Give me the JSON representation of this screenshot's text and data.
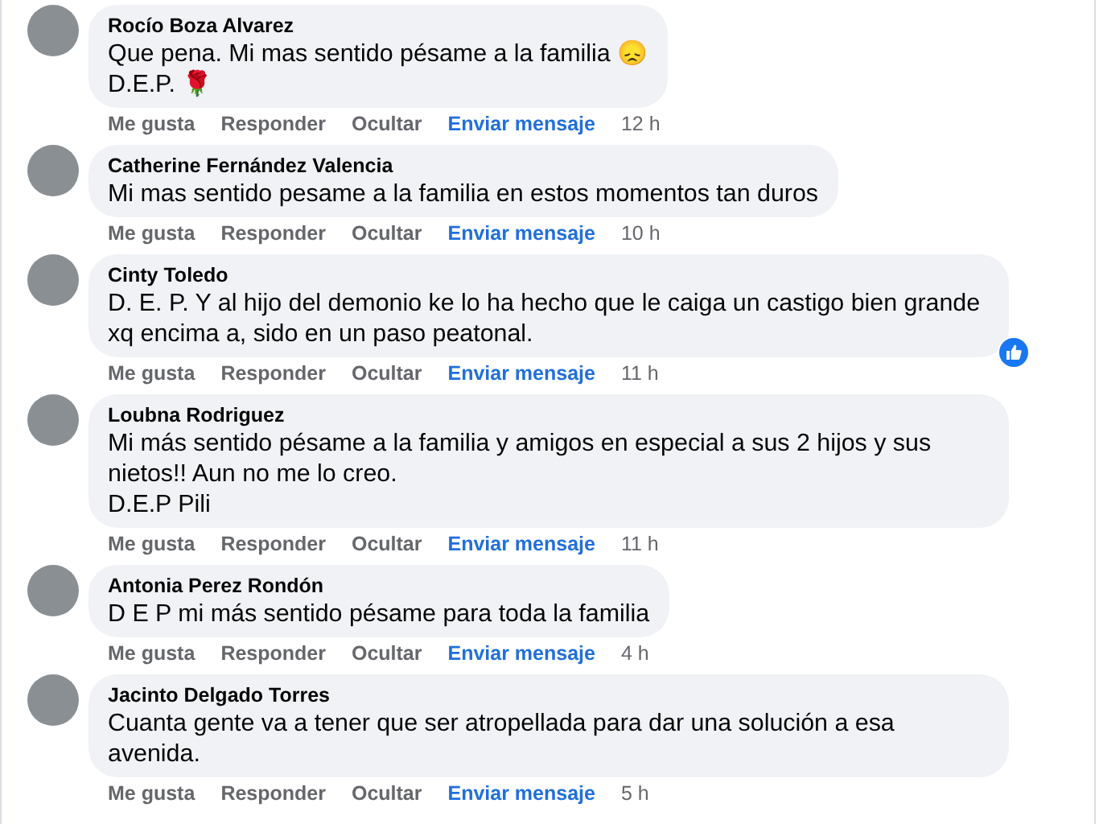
{
  "comments": [
    {
      "author": "Rocío Boza Alvarez",
      "text": "Que pena. Mi mas sentido pésame a la familia 😞\nD.E.P. 🌹",
      "actions": [
        "Me gusta",
        "Responder",
        "Ocultar",
        "Enviar mensaje"
      ],
      "time": "12 h"
    },
    {
      "author": "Catherine Fernández Valencia",
      "text": "Mi mas sentido pesame a la familia en estos momentos tan duros",
      "actions": [
        "Me gusta",
        "Responder",
        "Ocultar",
        "Enviar mensaje"
      ],
      "time": "10 h"
    },
    {
      "author": "Cinty Toledo",
      "text": "D. E. P. Y al hijo del demonio ke lo ha hecho que le caiga un castigo bien grande xq encima a, sido en un paso peatonal.",
      "actions": [
        "Me gusta",
        "Responder",
        "Ocultar",
        "Enviar mensaje"
      ],
      "time": "11 h",
      "liked": true
    },
    {
      "author": "Loubna Rodriguez",
      "text": "Mi más sentido pésame a la familia y amigos en especial a sus 2 hijos y sus nietos!! Aun no me lo creo.\nD.E.P Pili",
      "actions": [
        "Me gusta",
        "Responder",
        "Ocultar",
        "Enviar mensaje"
      ],
      "time": "11 h"
    },
    {
      "author": "Antonia Perez Rondón",
      "text": "D E P mi más sentido pésame para toda la familia",
      "actions": [
        "Me gusta",
        "Responder",
        "Ocultar",
        "Enviar mensaje"
      ],
      "time": "4 h"
    },
    {
      "author": "Jacinto Delgado Torres",
      "text": "Cuanta gente va a tener que ser atropellada para dar una solución a esa avenida.",
      "actions": [
        "Me gusta",
        "Responder",
        "Ocultar",
        "Enviar mensaje"
      ],
      "time": "5 h"
    }
  ]
}
